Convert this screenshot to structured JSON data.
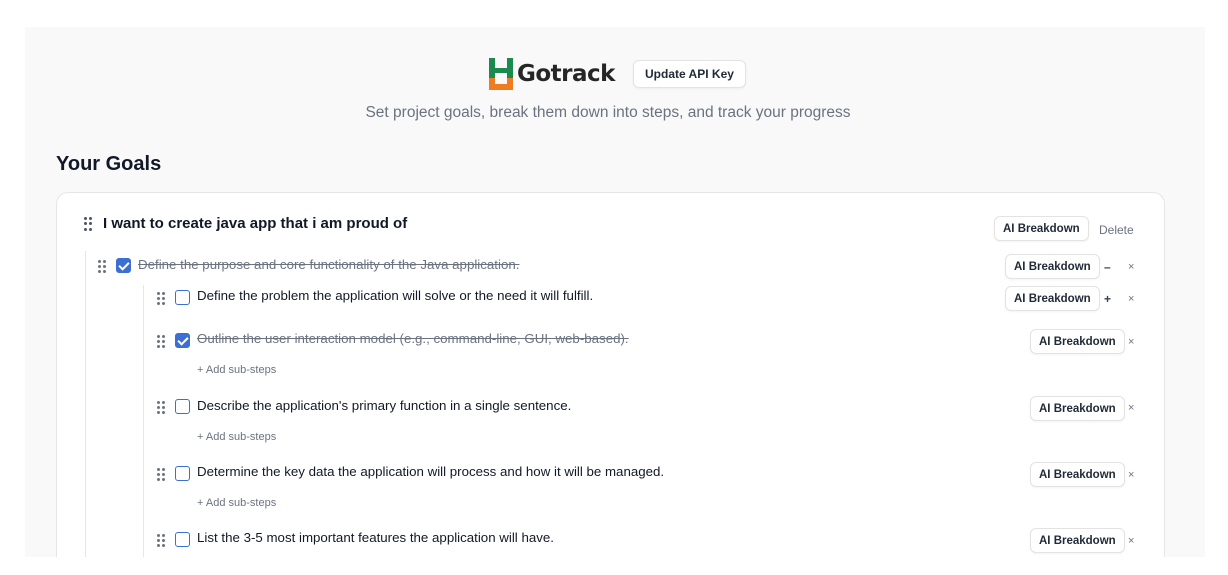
{
  "header": {
    "brand_name": "Gotrack",
    "update_api_key_label": "Update API Key",
    "tagline": "Set project goals, break them down into steps, and track your progress"
  },
  "goals_section": {
    "title": "Your Goals"
  },
  "goal": {
    "title": "I want to create java app that i am proud of",
    "ai_breakdown_label": "AI Breakdown",
    "delete_label": "Delete",
    "steps": [
      {
        "text": "Define the purpose and core functionality of the Java application.",
        "checked": true,
        "ai_label": "AI Breakdown",
        "toggle_label": "–",
        "remove_label": "×",
        "substeps": [
          {
            "text": "Define the problem the application will solve or the need it will fulfill.",
            "checked": false,
            "ai_label": "AI Breakdown",
            "toggle_label": "+",
            "remove_label": "×"
          },
          {
            "text": "Outline the user interaction model (e.g., command-line, GUI, web-based).",
            "checked": true,
            "ai_label": "AI Breakdown",
            "remove_label": "×",
            "add_label": "+ Add sub-steps"
          },
          {
            "text": "Describe the application's primary function in a single sentence.",
            "checked": false,
            "ai_label": "AI Breakdown",
            "remove_label": "×",
            "add_label": "+ Add sub-steps"
          },
          {
            "text": "Determine the key data the application will process and how it will be managed.",
            "checked": false,
            "ai_label": "AI Breakdown",
            "remove_label": "×",
            "add_label": "+ Add sub-steps"
          },
          {
            "text": "List the 3-5 most important features the application will have.",
            "checked": false,
            "ai_label": "AI Breakdown",
            "remove_label": "×"
          }
        ]
      }
    ]
  },
  "colors": {
    "logo_green": "#1b8a4f",
    "logo_orange": "#f07c21",
    "checkbox_blue": "#3b6fd4"
  }
}
